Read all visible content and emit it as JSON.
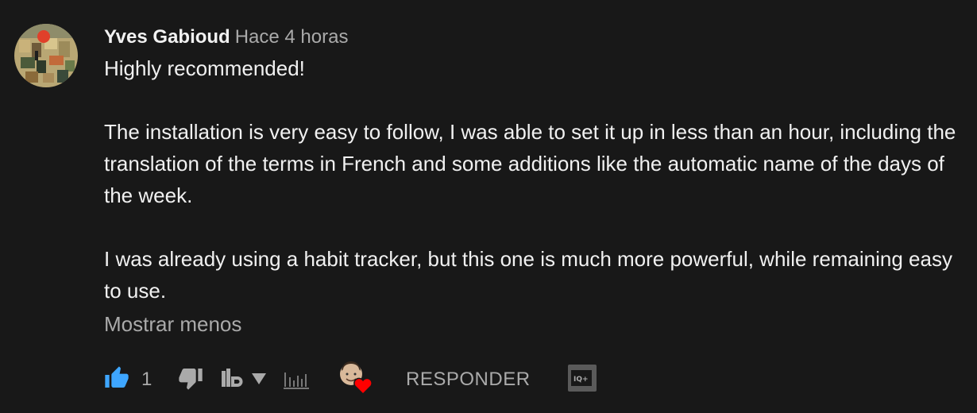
{
  "comment": {
    "author": "Yves Gabioud",
    "time": "Hace 4 horas",
    "paragraphs": [
      "Highly recommended!",
      "The installation is very easy to follow, I was able to set it up in less than an hour, including the translation of the terms in French and some additions like the automatic name of the days of the week.",
      "I was already using a habit tracker, but this one is much more powerful, while remaining easy to use."
    ],
    "show_less": "Mostrar menos"
  },
  "toolbar": {
    "like_count": "1",
    "reply_label": "RESPONDER"
  },
  "colors": {
    "background": "#181818",
    "text": "#f1f1f1",
    "muted": "#aaaaaa",
    "like_active": "#3ea6ff",
    "heart": "#ff0000"
  },
  "icons": [
    "thumbs-up-icon",
    "thumbs-down-icon",
    "tubebuddy-icon",
    "dropdown-triangle-icon",
    "bar-chart-icon",
    "creator-heart-icon",
    "iq-icon"
  ]
}
